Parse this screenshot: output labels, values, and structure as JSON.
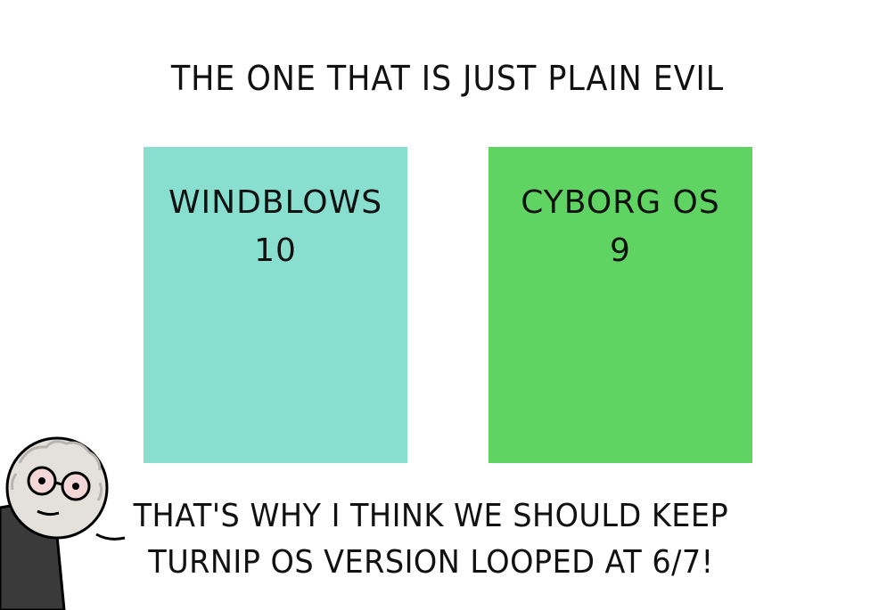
{
  "title": "THE ONE THAT IS JUST PLAIN EVIL",
  "panels": [
    {
      "name": "WINDBLOWS",
      "version": "10",
      "color": "#88dfcf"
    },
    {
      "name": "CYBORG OS",
      "version": "9",
      "color": "#60d463"
    }
  ],
  "caption": {
    "line1": "THAT'S WHY I THINK WE SHOULD KEEP",
    "line2": "TURNIP OS VERSION LOOPED AT 6/7!"
  },
  "character": {
    "icon": "bald-man-with-glasses-icon"
  }
}
